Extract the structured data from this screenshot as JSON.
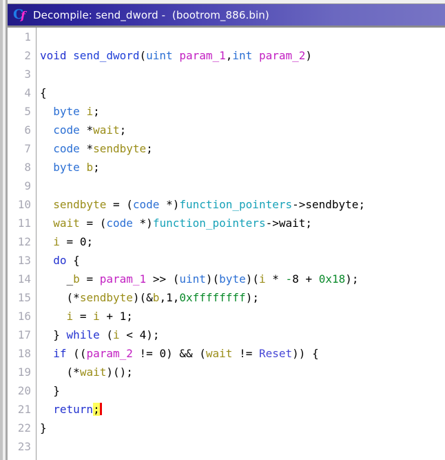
{
  "window": {
    "title": "Decompile: send_dword -  (bootrom_886.bin)",
    "icon": "decompiler-c-function-icon",
    "titlebar_gradient_start": "#221b86",
    "titlebar_gradient_end": "#7774c4",
    "titlebar_text_color": "#ffffff"
  },
  "editor": {
    "language": "c",
    "function_name": "send_dword",
    "binary": "bootrom_886.bin",
    "first_visible_line": 1,
    "last_visible_line": 23,
    "caret_line": 21,
    "caret_color": "#ee0000",
    "highlight_color": "#ffff5c",
    "gutter_color": "#a8a8b4",
    "colors": {
      "keyword": "#2332d0",
      "type": "#2b6fd4",
      "function": "#2040d8",
      "parameter": "#c21fc2",
      "variable": "#9a8d18",
      "global": "#17a2b8",
      "number": "#0b8a2b",
      "symbol": "#4646d6",
      "punctuation": "#000000",
      "background": "#ffffff"
    },
    "lines": [
      {
        "n": "1",
        "text": ""
      },
      {
        "n": "2",
        "text": "void send_dword(uint param_1,int param_2)"
      },
      {
        "n": "3",
        "text": ""
      },
      {
        "n": "4",
        "text": "{"
      },
      {
        "n": "5",
        "text": "  byte i;"
      },
      {
        "n": "6",
        "text": "  code *wait;"
      },
      {
        "n": "7",
        "text": "  code *sendbyte;"
      },
      {
        "n": "8",
        "text": "  byte b;"
      },
      {
        "n": "9",
        "text": ""
      },
      {
        "n": "10",
        "text": "  sendbyte = (code *)function_pointers->sendbyte;"
      },
      {
        "n": "11",
        "text": "  wait = (code *)function_pointers->wait;"
      },
      {
        "n": "12",
        "text": "  i = 0;"
      },
      {
        "n": "13",
        "text": "  do {"
      },
      {
        "n": "14",
        "text": "    _b = param_1 >> (uint)(byte)(i * -8 + 0x18);"
      },
      {
        "n": "15",
        "text": "    (*sendbyte)(&b,1,0xffffffff);"
      },
      {
        "n": "16",
        "text": "    i = i + 1;"
      },
      {
        "n": "17",
        "text": "  } while (i < 4);"
      },
      {
        "n": "18",
        "text": "  if ((param_2 != 0) && (wait != Reset)) {"
      },
      {
        "n": "19",
        "text": "    (*wait)();"
      },
      {
        "n": "20",
        "text": "  }"
      },
      {
        "n": "21",
        "text": "  return;"
      },
      {
        "n": "22",
        "text": "}"
      },
      {
        "n": "23",
        "text": ""
      }
    ]
  }
}
